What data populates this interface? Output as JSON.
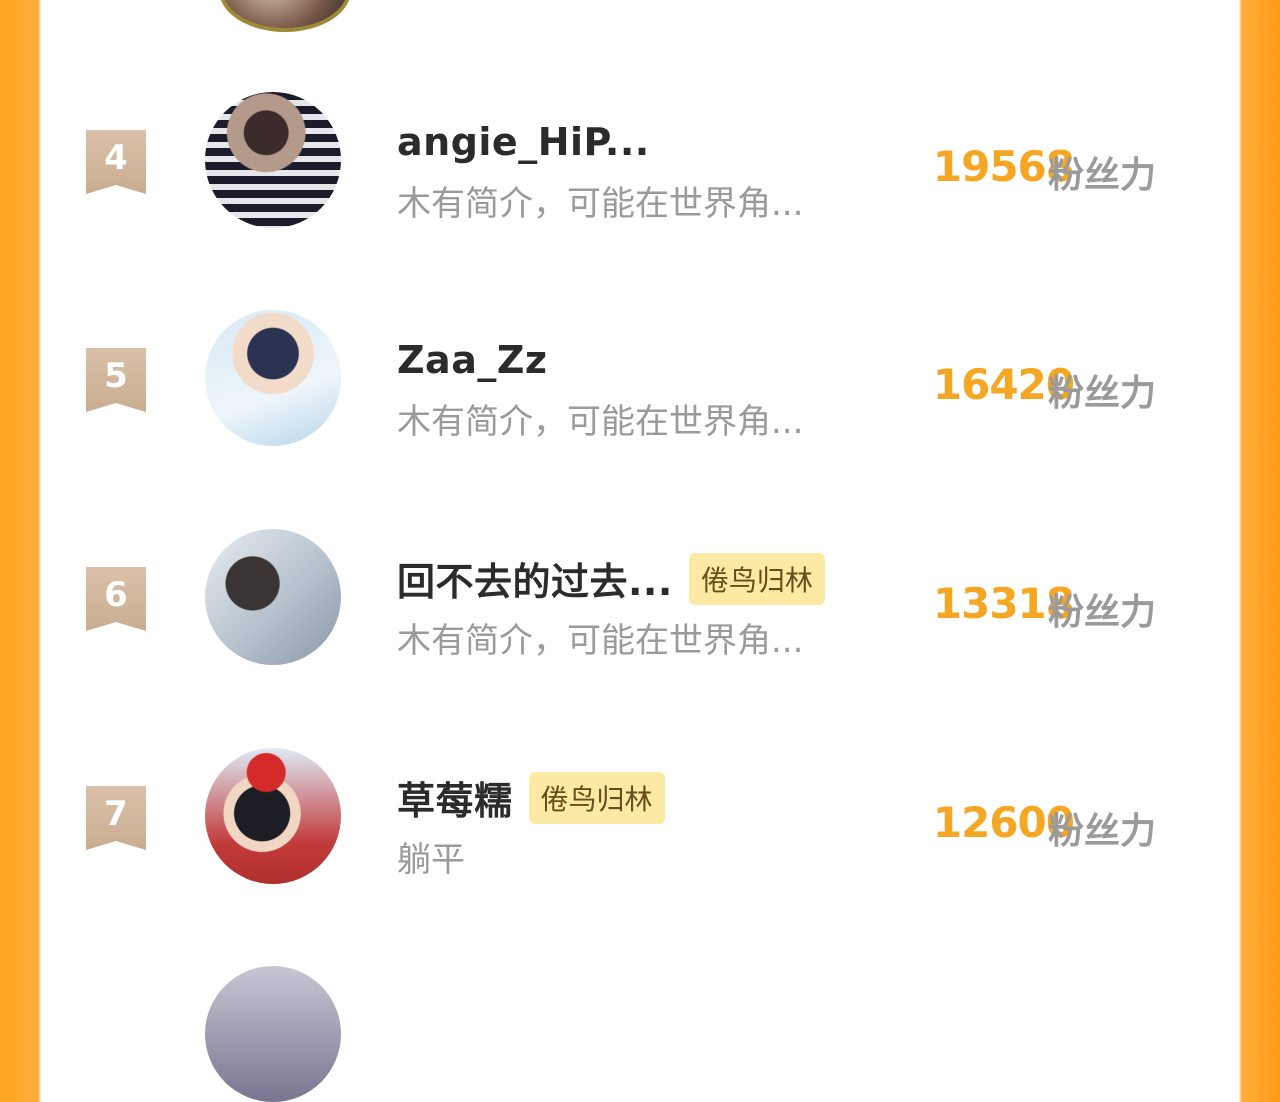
{
  "top_avatar": {
    "icon": "partial-avatar"
  },
  "rows": [
    {
      "rank": "4",
      "name": "angie_HiP...",
      "badge": "",
      "bio": "木有简介，可能在世界角...",
      "score": "19568",
      "unit": "粉丝力"
    },
    {
      "rank": "5",
      "name": "Zaa_Zz",
      "badge": "",
      "bio": "木有简介，可能在世界角...",
      "score": "16420",
      "unit": "粉丝力"
    },
    {
      "rank": "6",
      "name": "回不去的过去...",
      "badge": "倦鸟归林",
      "bio": "木有简介，可能在世界角...",
      "score": "13318",
      "unit": "粉丝力"
    },
    {
      "rank": "7",
      "name": "草莓糯",
      "badge": "倦鸟归林",
      "bio": "躺平",
      "score": "12600",
      "unit": "粉丝力"
    }
  ],
  "partial_next_name": "",
  "colors": {
    "accent": "#f5a623",
    "badge_bg": "#fbeaa3",
    "rank_bg": "#d9c0a8",
    "side": "#ffa321"
  }
}
